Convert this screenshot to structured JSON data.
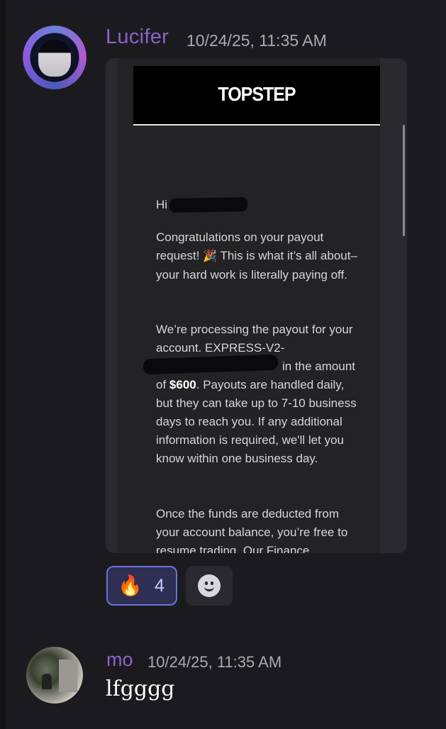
{
  "messages": [
    {
      "author": "Lucifer",
      "timestamp": "10/24/25, 11:35 AM",
      "author_color": "#8a63c9",
      "embed": {
        "logo": "TOPSTEP",
        "greeting": "Hi",
        "para1_a": "Congratulations on your payout request!",
        "para1_emoji": "🎉",
        "para1_b": "This is what it’s all about–your hard work is literally paying off.",
        "para2_a": "We’re processing the payout for your account. EXPRESS-V2-",
        "para2_b": "in the amount of",
        "para2_amount": "$600",
        "para2_c": ". Payouts are handled daily, but they can take up to 7-10 business days to reach you. If any additional information is required, we'll let you know within one business day.",
        "para3": "Once the funds are deducted from your account balance, you’re free to resume trading. Our Finance"
      },
      "reactions": [
        {
          "emoji": "🔥",
          "emoji_name": "fire-icon",
          "count": "4",
          "active": true
        }
      ],
      "add_reaction_icon": "smiley-icon"
    },
    {
      "author": "mo",
      "timestamp": "10/24/25, 11:35 AM",
      "author_color": "#8a63c9",
      "text": "lfgggg"
    }
  ],
  "theme": {
    "background": "#1b1b1f",
    "reaction_active_border": "#6a72d8"
  }
}
